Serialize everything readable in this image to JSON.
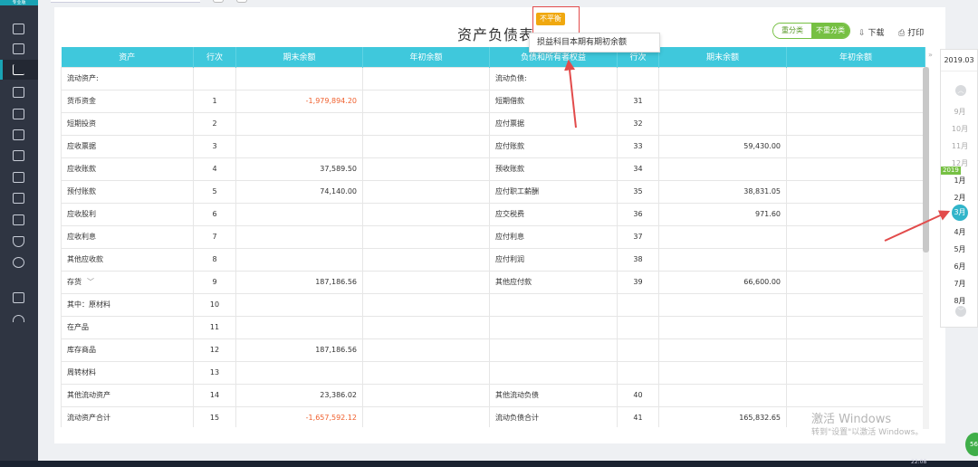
{
  "sidebar": {
    "logo": "专业版"
  },
  "report": {
    "title": "资产负债表",
    "badge": "不平衡",
    "popup": "损益科目本期有期初余额",
    "toggle": {
      "off": "重分类",
      "on": "不重分类"
    },
    "download": "下载",
    "print": "打印"
  },
  "table": {
    "headers": [
      "资产",
      "行次",
      "期末余额",
      "年初余额",
      "负债和所有者权益",
      "行次",
      "期末余额",
      "年初余额"
    ],
    "rows": [
      [
        "流动资产:",
        "",
        "",
        "",
        "流动负债:",
        "",
        "",
        ""
      ],
      [
        "货币资金",
        "1",
        "-1,979,894.20",
        "",
        "短期借款",
        "31",
        "",
        ""
      ],
      [
        "短期投资",
        "2",
        "",
        "",
        "应付票据",
        "32",
        "",
        ""
      ],
      [
        "应收票据",
        "3",
        "",
        "",
        "应付账款",
        "33",
        "59,430.00",
        ""
      ],
      [
        "应收账款",
        "4",
        "37,589.50",
        "",
        "预收账款",
        "34",
        "",
        ""
      ],
      [
        "预付账款",
        "5",
        "74,140.00",
        "",
        "应付职工薪酬",
        "35",
        "38,831.05",
        ""
      ],
      [
        "应收股利",
        "6",
        "",
        "",
        "应交税费",
        "36",
        "971.60",
        ""
      ],
      [
        "应收利息",
        "7",
        "",
        "",
        "应付利息",
        "37",
        "",
        ""
      ],
      [
        "其他应收款",
        "8",
        "",
        "",
        "应付利润",
        "38",
        "",
        ""
      ],
      [
        "存货",
        "9",
        "187,186.56",
        "",
        "其他应付款",
        "39",
        "66,600.00",
        ""
      ],
      [
        "其中：原材料",
        "10",
        "",
        "",
        "",
        "",
        "",
        ""
      ],
      [
        "在产品",
        "11",
        "",
        "",
        "",
        "",
        "",
        ""
      ],
      [
        "库存商品",
        "12",
        "187,186.56",
        "",
        "",
        "",
        "",
        ""
      ],
      [
        "周转材料",
        "13",
        "",
        "",
        "",
        "",
        "",
        ""
      ],
      [
        "其他流动资产",
        "14",
        "23,386.02",
        "",
        "其他流动负债",
        "40",
        "",
        ""
      ],
      [
        "流动资产合计",
        "15",
        "-1,657,592.12",
        "",
        "流动负债合计",
        "41",
        "165,832.65",
        ""
      ]
    ]
  },
  "period": {
    "current": "2019.03",
    "year": "2019",
    "months": [
      "9月",
      "10月",
      "11月",
      "12月",
      "1月",
      "2月",
      "3月",
      "4月",
      "5月",
      "6月",
      "7月",
      "8月"
    ]
  },
  "watermark": {
    "line1": "激活 Windows",
    "line2": "转到\"设置\"以激活 Windows。"
  },
  "taskbar": {
    "clock": "22:08",
    "badge": "56"
  },
  "colors": {
    "header": "#3fc8dc",
    "negative": "#f0612f",
    "accent_green": "#76c043",
    "badge": "#f0a80f",
    "arrow": "#e24b4b"
  }
}
